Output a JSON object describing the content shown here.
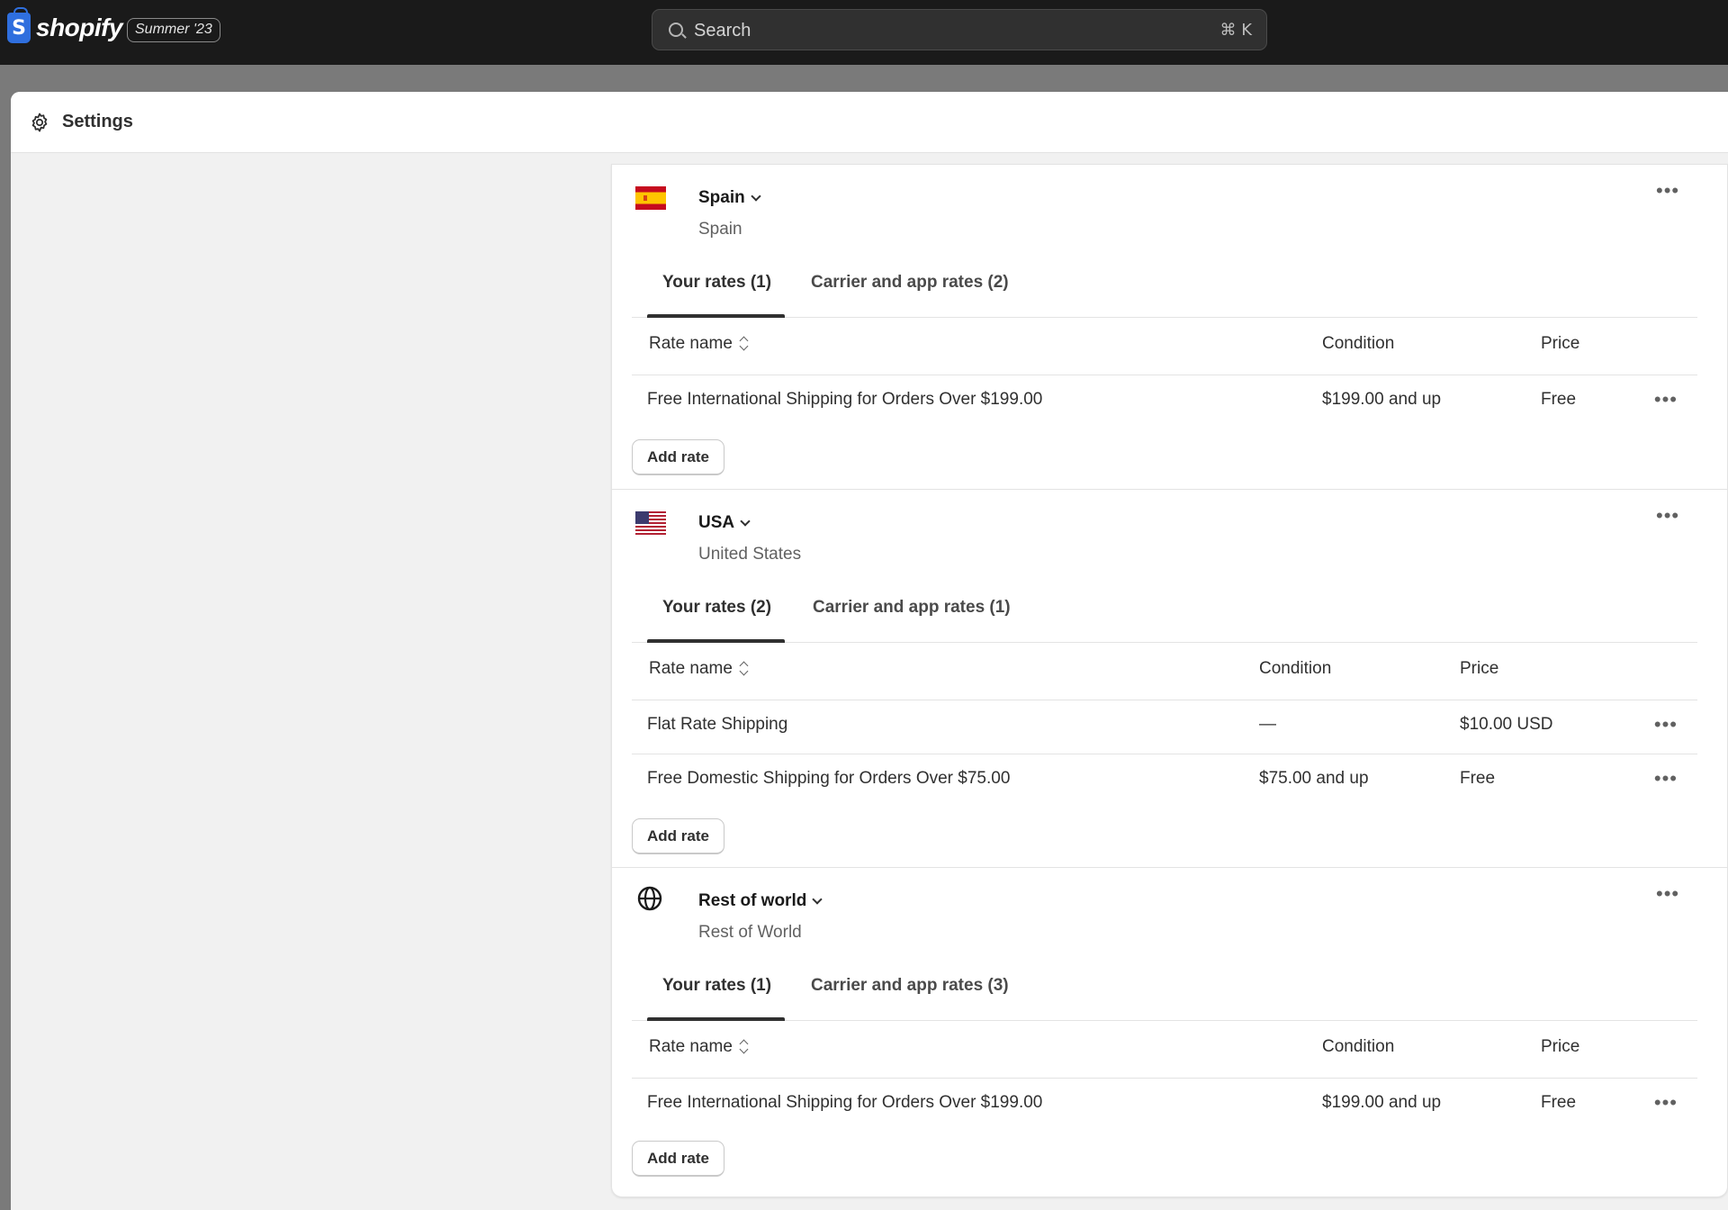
{
  "topbar": {
    "logo_text": "shopify",
    "logo_letter": "S",
    "edition_badge": "Summer '23",
    "search": {
      "placeholder": "Search",
      "shortcut": "⌘ K"
    }
  },
  "panel": {
    "title": "Settings"
  },
  "zones": [
    {
      "name": "Spain",
      "subtitle": "Spain",
      "flag": "spain-flag",
      "more": "•••",
      "tabs": [
        "Your rates (1)",
        "Carrier and app rates (2)"
      ],
      "columns": {
        "rate_name": "Rate name",
        "condition": "Condition",
        "price": "Price"
      },
      "rates": [
        {
          "name": "Free International Shipping for Orders Over $199.00",
          "condition": "$199.00 and up",
          "price": "Free",
          "more": "•••"
        }
      ],
      "add_rate": "Add rate"
    },
    {
      "name": "USA",
      "subtitle": "United States",
      "flag": "usa-flag",
      "more": "•••",
      "tabs": [
        "Your rates (2)",
        "Carrier and app rates (1)"
      ],
      "columns": {
        "rate_name": "Rate name",
        "condition": "Condition",
        "price": "Price"
      },
      "rates": [
        {
          "name": "Flat Rate Shipping",
          "condition": "—",
          "price": "$10.00 USD",
          "more": "•••"
        },
        {
          "name": "Free Domestic Shipping for Orders Over $75.00",
          "condition": "$75.00 and up",
          "price": "Free",
          "more": "•••"
        }
      ],
      "add_rate": "Add rate"
    },
    {
      "name": "Rest of world",
      "subtitle": "Rest of World",
      "flag": "globe-icon",
      "more": "•••",
      "tabs": [
        "Your rates (1)",
        "Carrier and app rates (3)"
      ],
      "columns": {
        "rate_name": "Rate name",
        "condition": "Condition",
        "price": "Price"
      },
      "rates": [
        {
          "name": "Free International Shipping for Orders Over $199.00",
          "condition": "$199.00 and up",
          "price": "Free",
          "more": "•••"
        }
      ],
      "add_rate": "Add rate"
    }
  ]
}
